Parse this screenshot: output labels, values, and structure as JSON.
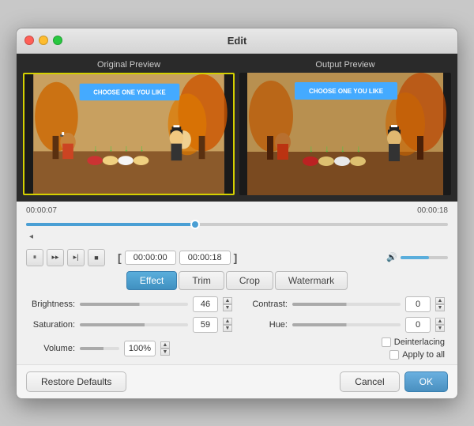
{
  "window": {
    "title": "Edit"
  },
  "preview": {
    "original_label": "Original Preview",
    "output_label": "Output Preview",
    "banner_text": "CHOOSE ONE YOU LIKE"
  },
  "timeline": {
    "start_time": "00:00:07",
    "end_time": "00:00:18",
    "caret": "◂"
  },
  "playback": {
    "pause_btn": "⏸",
    "next_frame_btn": "⏭",
    "step_btn": "▸|",
    "stop_btn": "■",
    "bracket_open": "[",
    "time_start": "00:00:00",
    "time_end": "00:00:18",
    "bracket_close": "]",
    "vol_icon": "🔊"
  },
  "tabs": {
    "items": [
      {
        "label": "Effect",
        "active": true
      },
      {
        "label": "Trim",
        "active": false
      },
      {
        "label": "Crop",
        "active": false
      },
      {
        "label": "Watermark",
        "active": false
      }
    ]
  },
  "params": {
    "brightness": {
      "label": "Brightness:",
      "value": "46"
    },
    "contrast": {
      "label": "Contrast:",
      "value": "0"
    },
    "saturation": {
      "label": "Saturation:",
      "value": "59"
    },
    "hue": {
      "label": "Hue:",
      "value": "0"
    },
    "volume": {
      "label": "Volume:",
      "value": "100%"
    },
    "deinterlacing": {
      "label": "Deinterlacing"
    },
    "apply_all": {
      "label": "Apply to all"
    }
  },
  "footer": {
    "restore_label": "Restore Defaults",
    "cancel_label": "Cancel",
    "ok_label": "OK"
  }
}
